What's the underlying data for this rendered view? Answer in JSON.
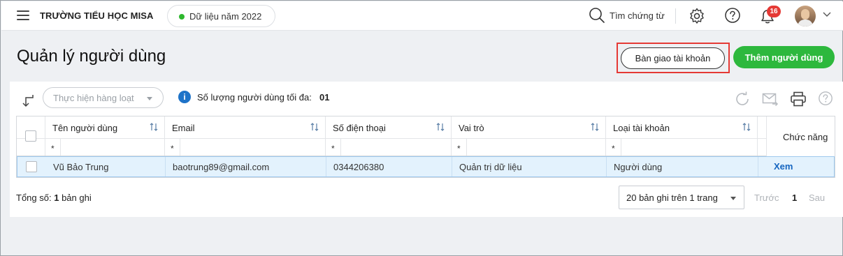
{
  "topbar": {
    "school_name": "TRƯỜNG TIỂU HỌC MISA",
    "data_year": "Dữ liệu năm 2022",
    "search_label": "Tìm chứng từ",
    "notification_count": "16",
    "accent_green": "#2eb82e"
  },
  "page": {
    "title": "Quản lý người dùng",
    "handover_button": "Bàn giao tài khoản",
    "add_user_button": "Thêm người dùng"
  },
  "toolbar": {
    "bulk_action_placeholder": "Thực hiện hàng loạt",
    "max_users_label": "Số lượng người dùng tối đa:",
    "max_users_value": "01"
  },
  "table": {
    "columns": [
      "Tên người dùng",
      "Email",
      "Số điện thoại",
      "Vai trò",
      "Loại tài khoản"
    ],
    "function_column": "Chức năng",
    "filter_symbol": "*",
    "rows": [
      {
        "name": "Vũ Bảo Trung",
        "email": "baotrung89@gmail.com",
        "phone": "0344206380",
        "role": "Quản trị dữ liệu",
        "account_type": "Người dùng",
        "action": "Xem"
      }
    ]
  },
  "footer": {
    "total_prefix": "Tổng số:",
    "total_count": "1",
    "total_suffix": "bản ghi",
    "page_size": "20 bản ghi trên 1 trang",
    "prev": "Trước",
    "current_page": "1",
    "next": "Sau"
  }
}
